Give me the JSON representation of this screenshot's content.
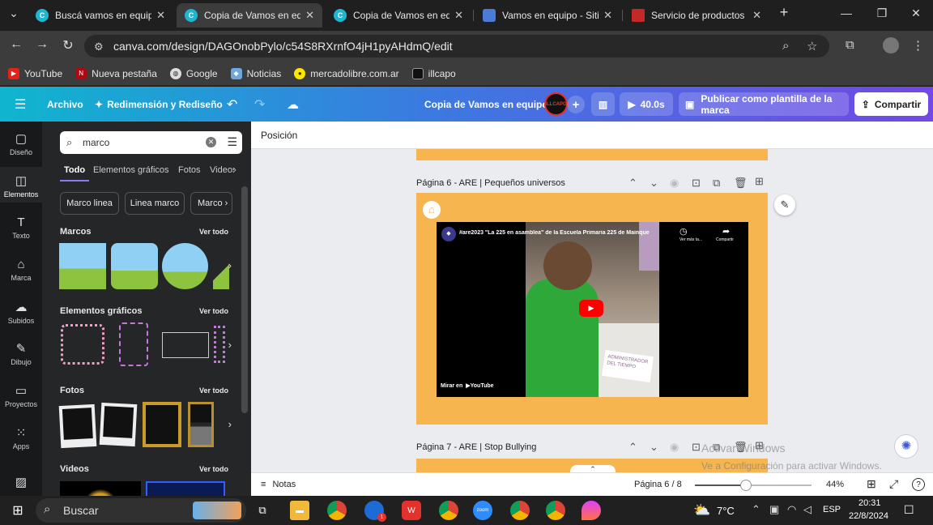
{
  "browser": {
    "tabs": [
      {
        "label": "Buscá vamos en equipo",
        "active": false
      },
      {
        "label": "Copia de Vamos en equipo",
        "active": true
      },
      {
        "label": "Copia de Vamos en equipo",
        "active": false
      },
      {
        "label": "Vamos en equipo - Sitio web",
        "active": false
      },
      {
        "label": "Servicio de productos originales",
        "active": false
      }
    ],
    "url": "canva.com/design/DAGOnobPylo/c54S8RXrnfO4jH1pyAHdmQ/edit",
    "bookmarks": [
      "YouTube",
      "Nueva pestaña",
      "Google",
      "Noticias",
      "mercadolibre.com.ar",
      "illcapo"
    ]
  },
  "header": {
    "file": "Archivo",
    "resize": "Redimensión y Rediseño",
    "doc_title": "Copia de Vamos en equipo",
    "play_time": "40.0s",
    "publish": "Publicar como plantilla de la marca",
    "share": "Compartir",
    "avatar_text": "ILLCAPO"
  },
  "rail": [
    "Diseño",
    "Elementos",
    "Texto",
    "Marca",
    "Subidos",
    "Dibujo",
    "Proyectos",
    "Apps"
  ],
  "panel": {
    "search_value": "marco",
    "tabs": [
      "Todo",
      "Elementos gráficos",
      "Fotos",
      "Videos"
    ],
    "chips": [
      "Marco linea",
      "Linea marco",
      "Marco"
    ],
    "sections": {
      "marcos": "Marcos",
      "graficos": "Elementos gráficos",
      "fotos": "Fotos",
      "videos": "Videos",
      "see_all": "Ver todo"
    }
  },
  "workspace": {
    "position_label": "Posición",
    "page6_title": "Página 6 - ARE | Pequeños universos",
    "page7_title": "Página 7 - ARE | Stop Bullying",
    "video": {
      "title": "#are2023 \"La 225 en asamblea\" de la Escuela Primaria 225 de Mainque",
      "watch_later": "Ver más ta...",
      "share": "Compartir",
      "watch_on": "Mirar en",
      "youtube": "YouTube",
      "sign": "ADMINISTRADOR DEL TIEMPO"
    },
    "watermark": "Activar Windows",
    "watermark_sub": "Ve a Configuración para activar Windows."
  },
  "bottom": {
    "notes": "Notas",
    "page_indicator": "Página 6 / 8",
    "zoom": "44%",
    "zoom_fraction": 0.44
  },
  "taskbar": {
    "search": "Buscar",
    "temp": "7°C",
    "lang": "ESP",
    "time": "20:31",
    "date": "22/8/2024",
    "notif_count": "1"
  },
  "colors": {
    "canva_gradient_start": "#0fb5cf",
    "canva_gradient_end": "#7248e6",
    "page_orange": "#f6b54e"
  }
}
